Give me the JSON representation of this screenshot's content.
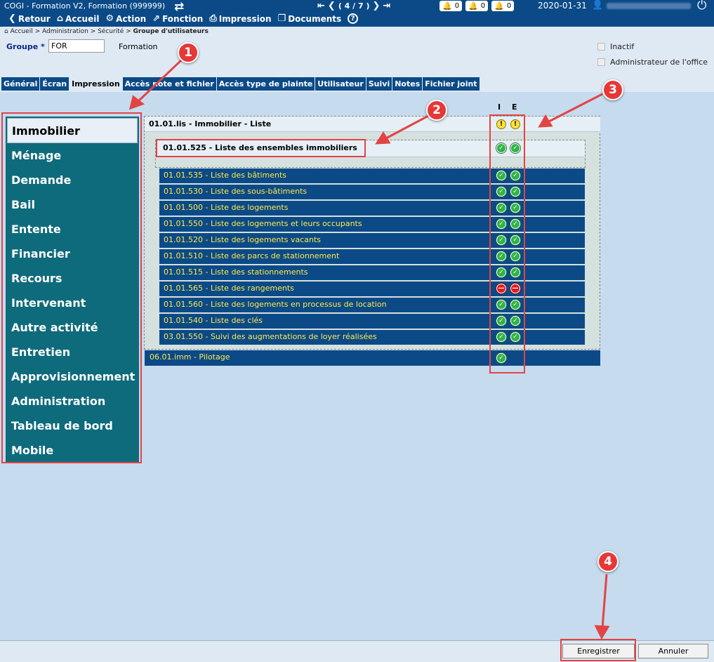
{
  "topbar": {
    "title": "COGI - Formation V2, Formation (999999)",
    "toolbar": [
      {
        "icon": "chevron-left-icon",
        "glyph": "❮",
        "label": "Retour"
      },
      {
        "icon": "home-icon",
        "glyph": "⌂",
        "label": "Accueil"
      },
      {
        "icon": "action-icon",
        "glyph": "⚙",
        "label": "Action"
      },
      {
        "icon": "function-icon",
        "glyph": "⇗",
        "label": "Fonction"
      },
      {
        "icon": "printer-icon",
        "glyph": "⎙",
        "label": "Impression"
      },
      {
        "icon": "documents-icon",
        "glyph": "❐",
        "label": "Documents"
      },
      {
        "icon": "help-icon",
        "glyph": "?",
        "label": ""
      }
    ],
    "record_nav": "( 4 / 7 )",
    "alerts": [
      {
        "color": "#e01c23",
        "count": "0"
      },
      {
        "color": "#f0b400",
        "count": "0"
      },
      {
        "color": "#2fb34a",
        "count": "0"
      }
    ],
    "date": "2020-01-31"
  },
  "header": {
    "breadcrumb": "Accueil > Administration > Sécurité > ",
    "breadcrumb_current": "Groupe d'utilisateurs",
    "group_label": "Groupe *",
    "group_value": "FOR",
    "group_desc": "Formation",
    "checkbox_inactif": "Inactif",
    "checkbox_admin": "Administrateur de l'office"
  },
  "tabs": [
    "Général",
    "Écran",
    "Impression",
    "Accès note et fichier",
    "Accès type de plainte",
    "Utilisateur",
    "Suivi",
    "Notes",
    "Fichier joint"
  ],
  "active_tab": "Impression",
  "menu": [
    "Immobilier",
    "Ménage",
    "Demande",
    "Bail",
    "Entente",
    "Financier",
    "Recours",
    "Intervenant",
    "Autre activité",
    "Entretien",
    "Approvisionnement",
    "Administration",
    "Tableau de bord",
    "Mobile"
  ],
  "columns": {
    "i": "I",
    "e": "E"
  },
  "parent_row": {
    "label": "01.01.lis - Immobilier - Liste",
    "i": "warn",
    "e": "warn"
  },
  "sub_row": {
    "label": "01.01.525 - Liste des ensembles immobiliers",
    "i": "ok",
    "e": "ok"
  },
  "items": [
    {
      "label": "01.01.535 - Liste des bâtiments",
      "i": "ok",
      "e": "ok"
    },
    {
      "label": "01.01.530 - Liste des sous-bâtiments",
      "i": "ok",
      "e": "ok"
    },
    {
      "label": "01.01.500 - Liste des logements",
      "i": "ok",
      "e": "ok"
    },
    {
      "label": "01.01.550 - Liste des logements et leurs occupants",
      "i": "ok",
      "e": "ok"
    },
    {
      "label": "01.01.520 - Liste des logements vacants",
      "i": "ok",
      "e": "ok"
    },
    {
      "label": "01.01.510 - Liste des parcs de stationnement",
      "i": "ok",
      "e": "ok"
    },
    {
      "label": "01.01.515 - Liste des stationnements",
      "i": "ok",
      "e": "ok"
    },
    {
      "label": "01.01.565 - Liste des rangements",
      "i": "no",
      "e": "no"
    },
    {
      "label": "01.01.560 - Liste des logements en processus de location",
      "i": "ok",
      "e": "ok"
    },
    {
      "label": "01.01.540 - Liste des clés",
      "i": "ok",
      "e": "ok"
    },
    {
      "label": "03.01.550 - Suivi des augmentations de loyer réalisées",
      "i": "ok",
      "e": "ok"
    }
  ],
  "bottom_row": {
    "label": "06.01.imm - Pilotage",
    "i": "ok"
  },
  "footer": {
    "save": "Enregistrer",
    "cancel": "Annuler"
  },
  "annotations": [
    "1",
    "2",
    "3",
    "4"
  ],
  "colors": {
    "accent": "#0b4a87",
    "menu": "#0e6b7c",
    "annotation": "#e24444",
    "item_text": "#ffe94a"
  }
}
